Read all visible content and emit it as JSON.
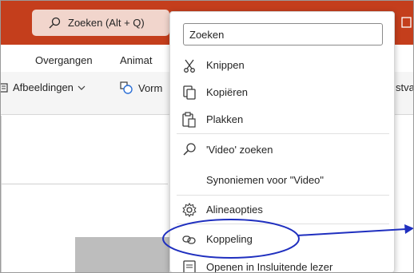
{
  "titlebar": {
    "search_label": "Zoeken (Alt + Q)",
    "color": "#c43e1c"
  },
  "ribbon_tabs": [
    {
      "label": "Overgangen"
    },
    {
      "label": "Animat"
    }
  ],
  "ribbon_tools": {
    "images_label": "Afbeeldingen",
    "shapes_label": "Vorm",
    "right_partial_label": "stval"
  },
  "context_menu": {
    "search_placeholder": "Zoeken",
    "items": [
      {
        "label": "Knippen",
        "icon": "scissors-icon"
      },
      {
        "label": "Kopiëren",
        "icon": "copy-icon"
      },
      {
        "label": "Plakken",
        "icon": "paste-icon"
      },
      {
        "label": "'Video' zoeken",
        "icon": "search-icon"
      },
      {
        "label": "Synoniemen voor \"Video\"",
        "icon": ""
      },
      {
        "label": "Alineaopties",
        "icon": "paragraph-settings-icon"
      },
      {
        "label": "Koppeling",
        "icon": "link-icon"
      },
      {
        "label": "Openen in Insluitende lezer",
        "icon": "immersive-reader-icon"
      }
    ]
  },
  "annotation": {
    "color": "#1f2fbf",
    "highlighted_item": "Koppeling"
  }
}
